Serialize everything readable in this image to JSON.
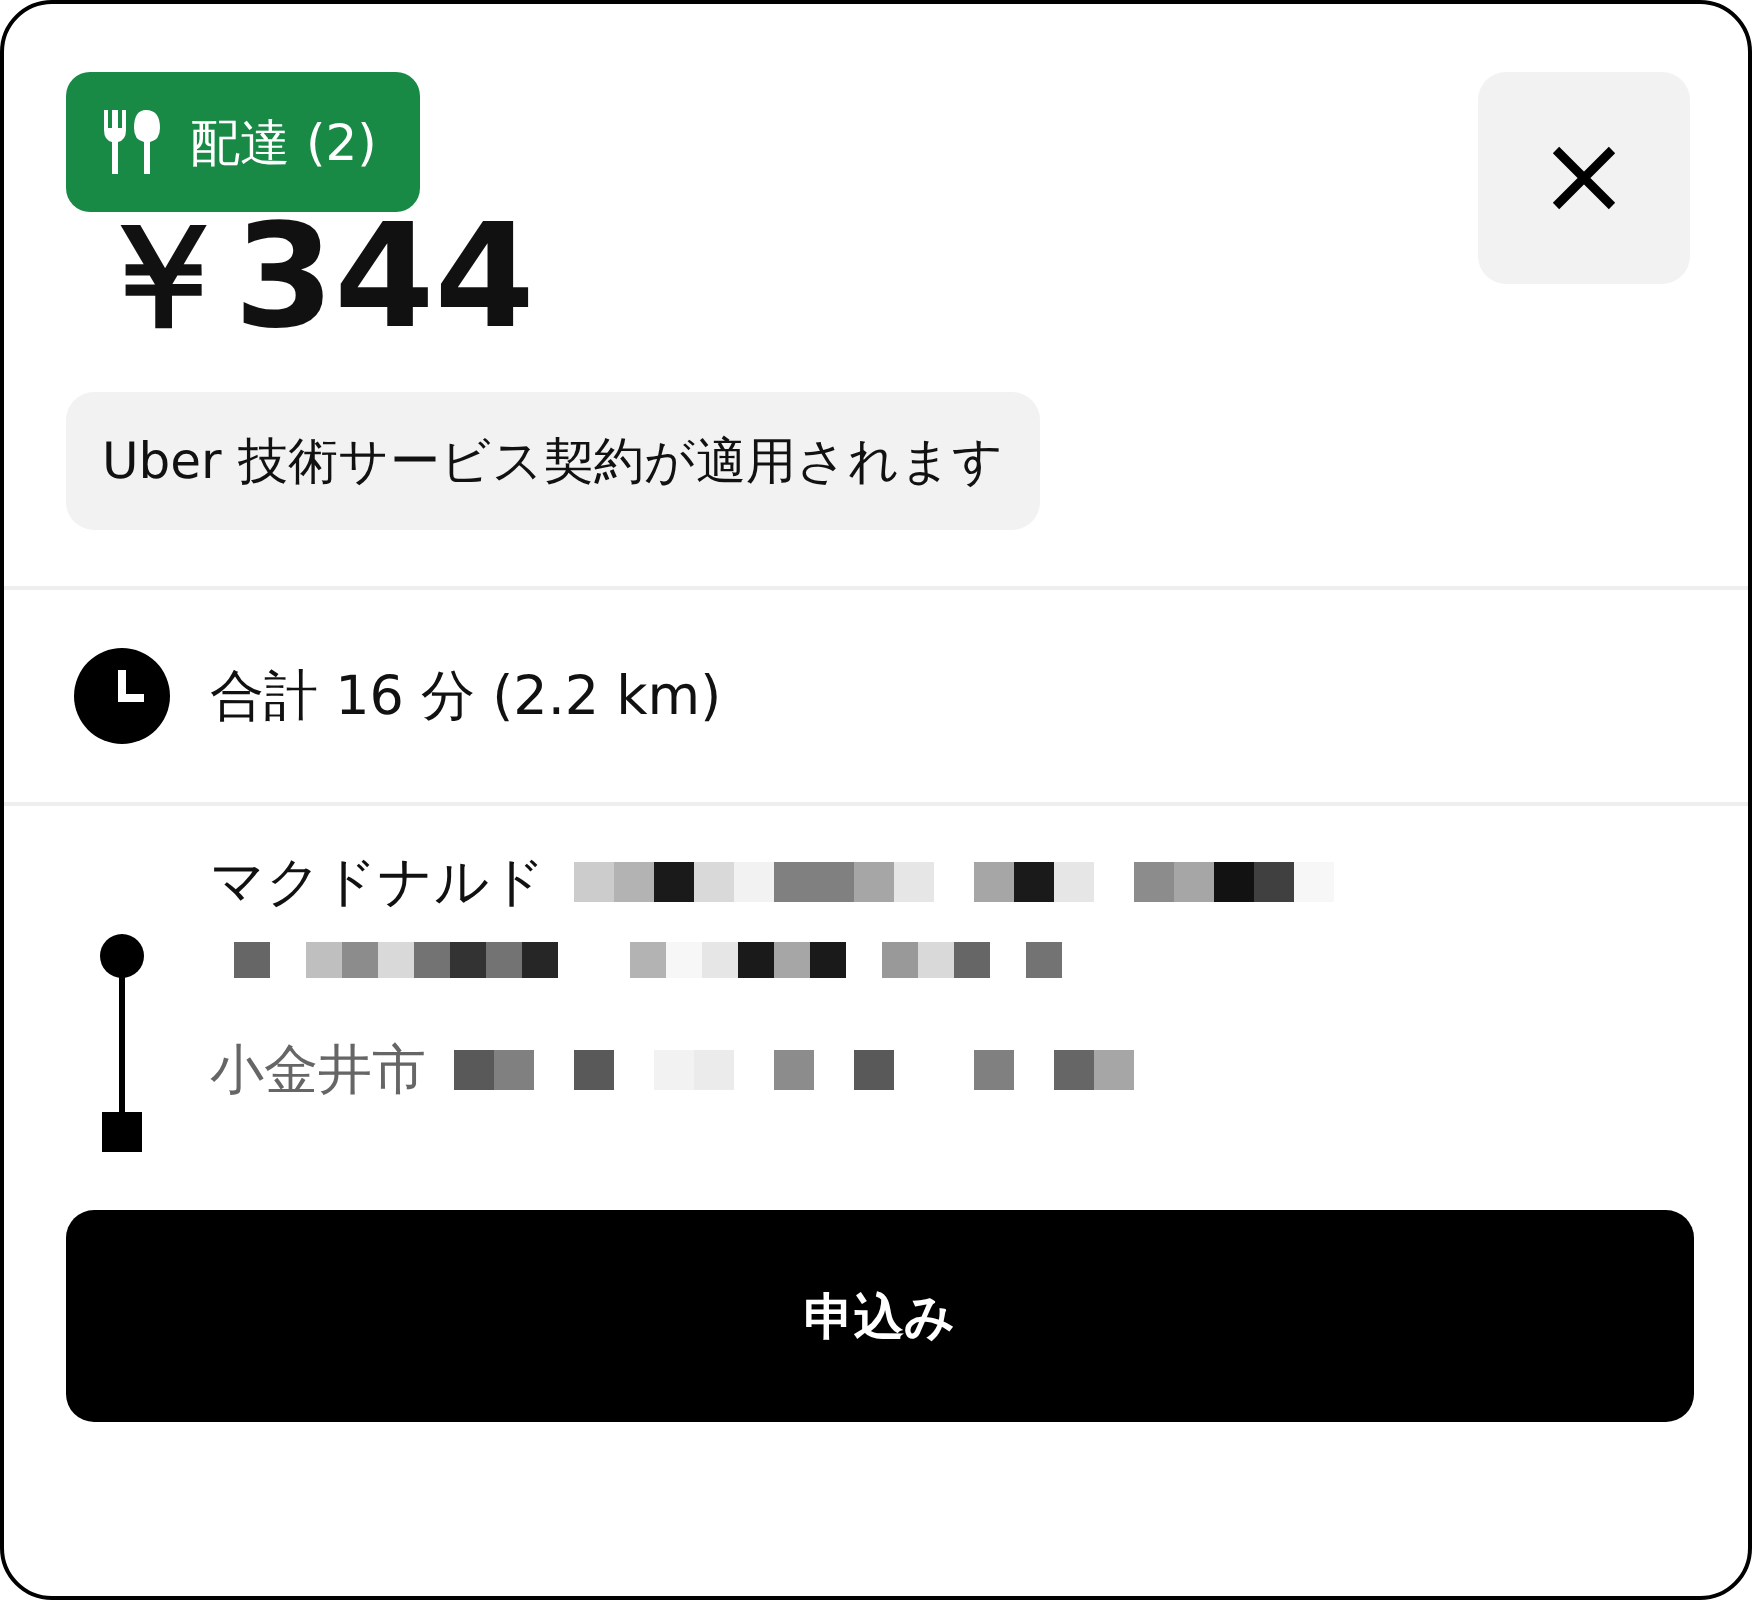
{
  "badge": {
    "label": "配達 (2)"
  },
  "fare": "￥344",
  "notice": "Uber 技術サービス契約が適用されます",
  "trip_summary": "合計 16 分 (2.2 km)",
  "route": [
    {
      "kind": "pickup",
      "text": "マクドナルド"
    },
    {
      "kind": "dropoff",
      "text": "小金井市"
    }
  ],
  "accept_button": "申込み"
}
